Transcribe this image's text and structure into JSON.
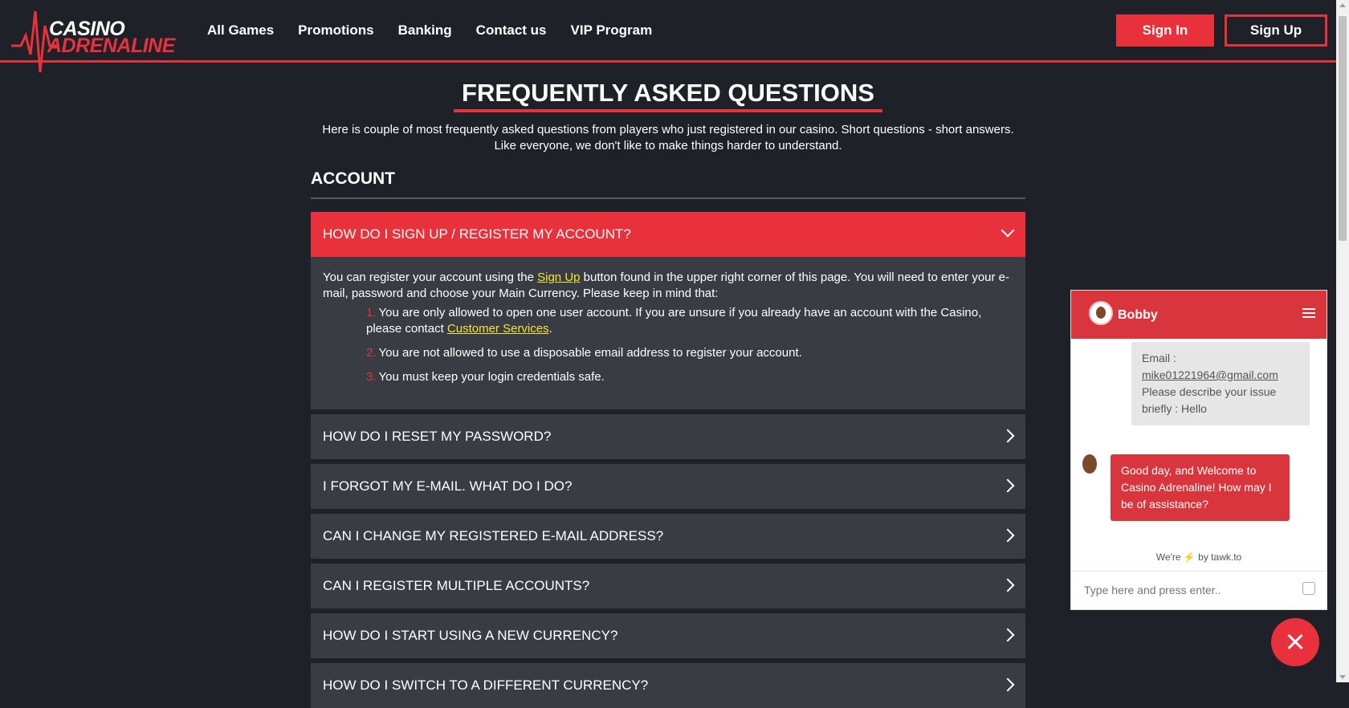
{
  "header": {
    "logo_line1": "CASINO",
    "logo_line2": "ADRENALINE",
    "nav": [
      "All Games",
      "Promotions",
      "Banking",
      "Contact us",
      "VIP Program"
    ],
    "sign_in": "Sign In",
    "sign_up": "Sign Up"
  },
  "page": {
    "title": "FREQUENTLY ASKED QUESTIONS",
    "intro": "Here is couple of most frequently asked questions from players who just registered in our casino. Short questions - short answers. Like everyone, we don't like to make things harder to understand.",
    "section": "ACCOUNT"
  },
  "faq": {
    "open_question": "HOW DO I SIGN UP / REGISTER MY ACCOUNT?",
    "answer_part1": "You can register your account using the ",
    "answer_link": "Sign Up",
    "answer_part2": " button found in the upper right corner of this page. You will need to enter your e-mail, password and choose your Main Currency. Please keep in mind that:",
    "rules": [
      {
        "num": "1.",
        "text": "You are only allowed to open one user account. If you are unsure if you already have an account with the Casino, please contact ",
        "link": "Customer Services",
        "after": "."
      },
      {
        "num": "2.",
        "text": "You are not allowed to use a disposable email address to register your account.",
        "link": "",
        "after": ""
      },
      {
        "num": "3.",
        "text": "You must keep your login credentials safe.",
        "link": "",
        "after": ""
      }
    ],
    "questions": [
      "HOW DO I RESET MY PASSWORD?",
      "I FORGOT MY E-MAIL. WHAT DO I DO?",
      "CAN I CHANGE MY REGISTERED E-MAIL ADDRESS?",
      "CAN I REGISTER MULTIPLE ACCOUNTS?",
      "HOW DO I START USING A NEW CURRENCY?",
      "HOW DO I SWITCH TO A DIFFERENT CURRENCY?"
    ]
  },
  "chat": {
    "agent_name": "Bobby",
    "visitor_email_label": "Email :",
    "visitor_email": "mike01221964@gmail.com",
    "visitor_issue": "Please describe your issue briefly : Hello",
    "agent_message": "Good day, and Welcome to Casino Adrenaline! How may I be of assistance?",
    "powered_prefix": "We're",
    "powered_suffix": "by tawk.to",
    "input_placeholder": "Type here and press enter.."
  },
  "colors": {
    "accent": "#e8313a",
    "background": "#1f2129",
    "panel": "#3a3c43",
    "link": "#f3e535"
  }
}
